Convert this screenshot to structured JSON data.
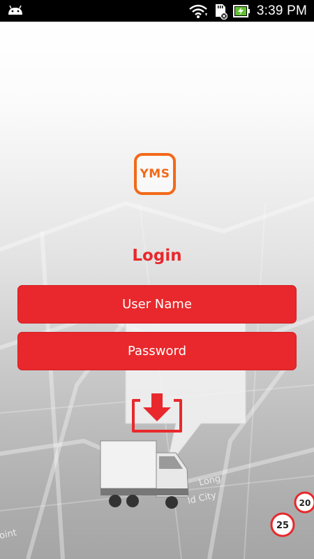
{
  "status_bar": {
    "time": "3:39 PM",
    "icons": [
      "android-icon",
      "wifi-icon",
      "sd-card-icon",
      "battery-charging-icon"
    ]
  },
  "logo": {
    "text": "YMS"
  },
  "login": {
    "title": "Login",
    "username_placeholder": "User Name",
    "password_placeholder": "Password",
    "submit_icon": "download-icon"
  },
  "colors": {
    "accent": "#e8282c",
    "logo": "#f16a1a"
  },
  "map_labels": {
    "speed_a": "25",
    "speed_b": "20",
    "road_a": "Long",
    "road_b": "ld City",
    "road_c": "oint"
  }
}
